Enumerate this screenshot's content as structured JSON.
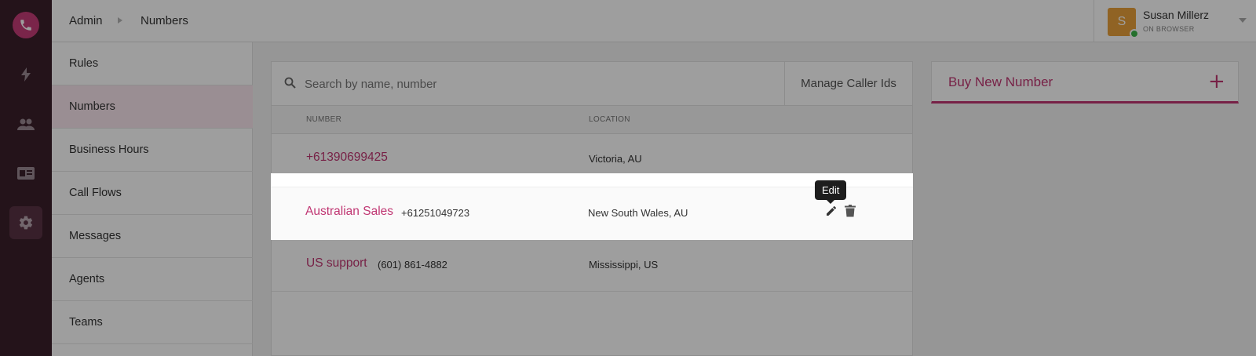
{
  "breadcrumb": {
    "root": "Admin",
    "current": "Numbers"
  },
  "user": {
    "initial": "S",
    "name": "Susan Millerz",
    "status": "ON BROWSER"
  },
  "rail": {
    "icons": [
      "phone-icon",
      "lightning-icon",
      "people-icon",
      "contact-card-icon",
      "settings-icon"
    ],
    "active": "settings-icon"
  },
  "subnav": {
    "items": [
      {
        "label": "Rules"
      },
      {
        "label": "Numbers"
      },
      {
        "label": "Business Hours"
      },
      {
        "label": "Call Flows"
      },
      {
        "label": "Messages"
      },
      {
        "label": "Agents"
      },
      {
        "label": "Teams"
      }
    ],
    "active": "Numbers"
  },
  "search": {
    "placeholder": "Search by name, number",
    "value": ""
  },
  "manage_caller_ids": "Manage Caller Ids",
  "table": {
    "headers": {
      "number": "NUMBER",
      "location": "LOCATION"
    },
    "rows": [
      {
        "name": "+61390699425",
        "number": "",
        "location": "Victoria, AU"
      },
      {
        "name": "Australian Sales",
        "number": "+61251049723",
        "location": "New South Wales, AU"
      },
      {
        "name": "US support",
        "number": "(601) 861-4882",
        "location": "Mississippi, US"
      }
    ]
  },
  "tooltip": "Edit",
  "buy_new_number": {
    "label": "Buy New Number",
    "icon": "+"
  },
  "colors": {
    "accent": "#c03672",
    "rail": "#3a1f2b",
    "active_nav": "#f8e6ee"
  }
}
